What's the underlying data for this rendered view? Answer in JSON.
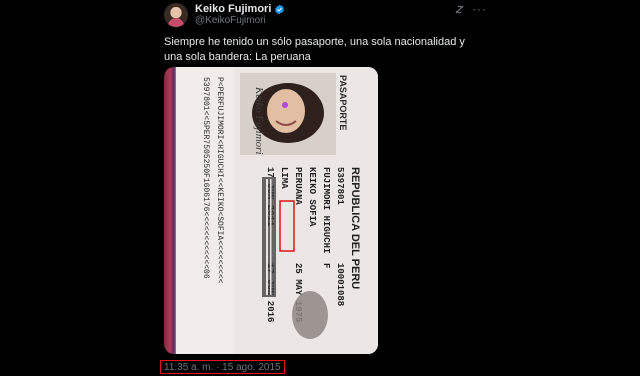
{
  "author": {
    "name": "Keiko Fujimori",
    "handle": "@KeikoFujimori",
    "verified_icon": "verified-badge-icon"
  },
  "tweet": {
    "text": "Siempre he tenido un sólo pasaporte, una sola nacionalidad y una sola bandera: La peruana",
    "timestamp": "11:35 a. m. · 15 ago. 2015"
  },
  "image": {
    "passport_header": "PASAPORTE",
    "country": "REPUBLICA DEL PERU",
    "number": "5397801",
    "surname": "FUJIMORI HIGUCHI",
    "given_names": "KEIKO SOFIA",
    "nationality": "PERUANA",
    "place": "LIMA",
    "issue_date": "17 JUN 2011",
    "birth_date": "25 MAY 1975",
    "expiry_date": "17 JUN 2016",
    "id_number": "10001088",
    "sex": "F",
    "mrz_line1": "P<PERFUJIMORI<HIGUCHI<<KEIKO<SOFIA<<<<<<<<<",
    "mrz_line2": "5397801<<5PER7505250F1606176<<<<<<<<<<<<06",
    "signature_text": "Keiko Fujimori"
  },
  "colors": {
    "background": "#000000",
    "highlight": "#e0141b",
    "secondary_text": "#71767b",
    "verified": "#1d9bf0"
  }
}
